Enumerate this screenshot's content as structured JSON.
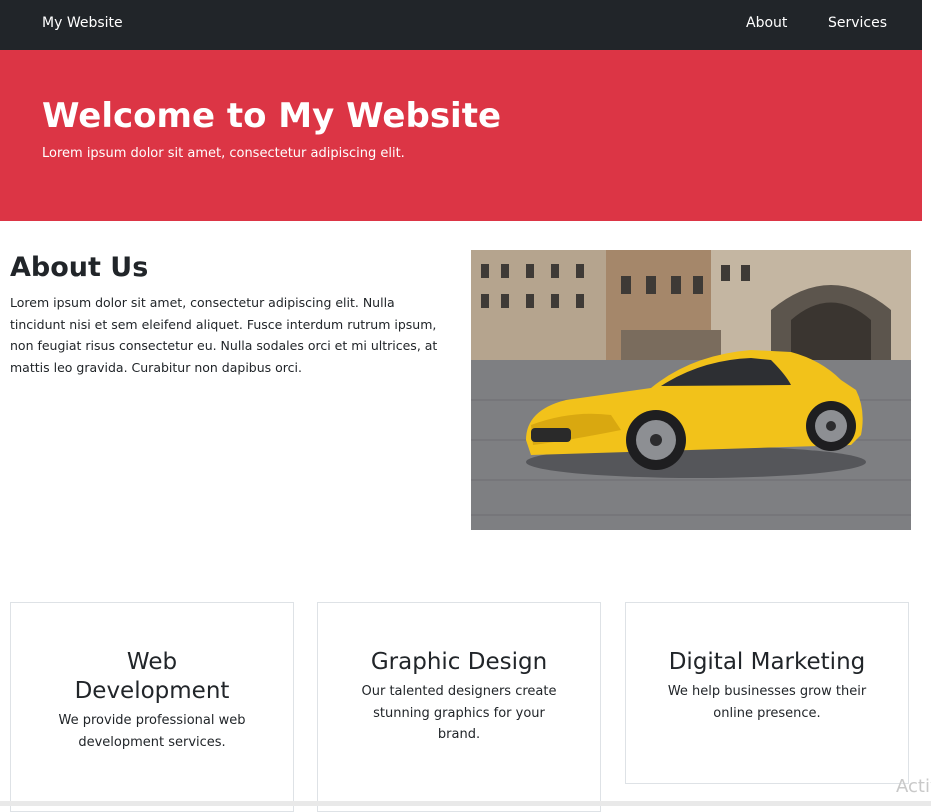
{
  "nav": {
    "brand": "My Website",
    "links": [
      "About",
      "Services"
    ]
  },
  "hero": {
    "title": "Welcome to My Website",
    "subtitle": "Lorem ipsum dolor sit amet, consectetur adipiscing elit."
  },
  "about": {
    "title": "About Us",
    "text": "Lorem ipsum dolor sit amet, consectetur adipiscing elit. Nulla tincidunt nisi et sem eleifend aliquet. Fusce interdum rutrum ipsum, non feugiat risus consectetur eu. Nulla sodales orci et mi ultrices, at mattis leo gravida. Curabitur non dapibus orci."
  },
  "services": [
    {
      "title": "Web Development",
      "text": "We provide professional web development services."
    },
    {
      "title": "Graphic Design",
      "text": "Our talented designers create stunning graphics for your brand."
    },
    {
      "title": "Digital Marketing",
      "text": "We help businesses grow their online presence."
    }
  ],
  "watermark": "Activ",
  "colors": {
    "navbar": "#212529",
    "hero": "#dc3545",
    "car": "#f2c21a"
  }
}
